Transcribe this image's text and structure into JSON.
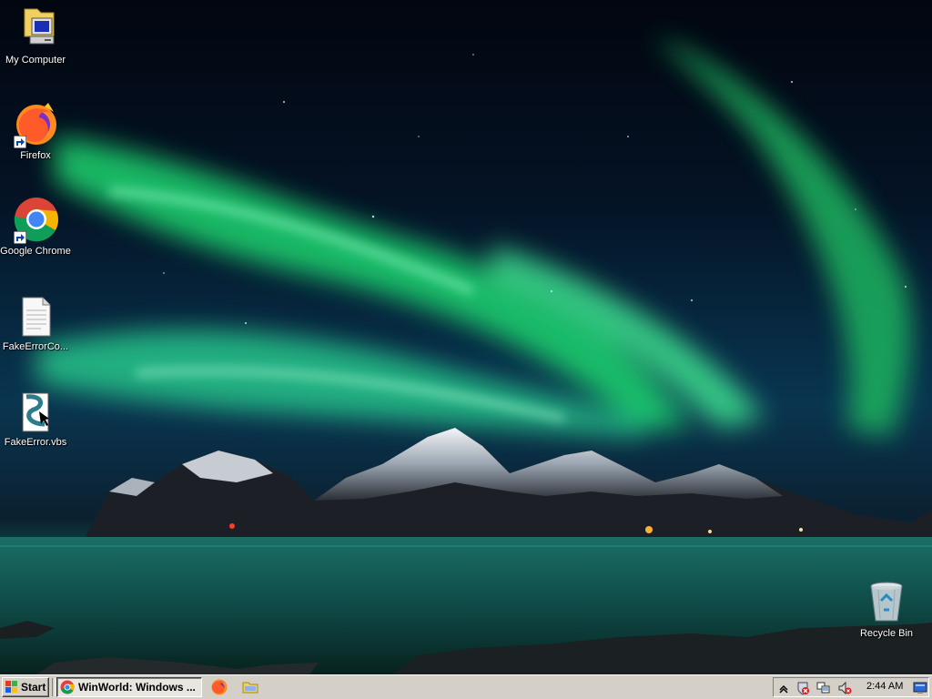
{
  "desktop": {
    "icons": [
      {
        "label": "My Computer",
        "icon": "my-computer-icon"
      },
      {
        "label": "Firefox",
        "icon": "firefox-icon"
      },
      {
        "label": "Google Chrome",
        "icon": "chrome-icon"
      },
      {
        "label": "FakeErrorCo...",
        "icon": "text-file-icon"
      },
      {
        "label": "FakeError.vbs",
        "icon": "vbs-script-icon"
      },
      {
        "label": "Recycle Bin",
        "icon": "recycle-bin-icon"
      }
    ]
  },
  "taskbar": {
    "start_label": "Start",
    "tasks": [
      {
        "label": "WinWorld: Windows ...",
        "icon": "chrome-icon"
      }
    ],
    "quick_launch": [
      {
        "icon": "firefox-icon"
      },
      {
        "icon": "folder-icon"
      }
    ],
    "tray": {
      "icons": [
        "expand-tray-icon",
        "security-alert-icon",
        "network-icon",
        "volume-muted-icon",
        "desktop-icon"
      ],
      "clock": "2:44 AM"
    }
  },
  "colors": {
    "taskbar": "#d4d0c8",
    "aurora": "#2bd98a",
    "sky": "#041325",
    "water": "#0d4a44"
  }
}
